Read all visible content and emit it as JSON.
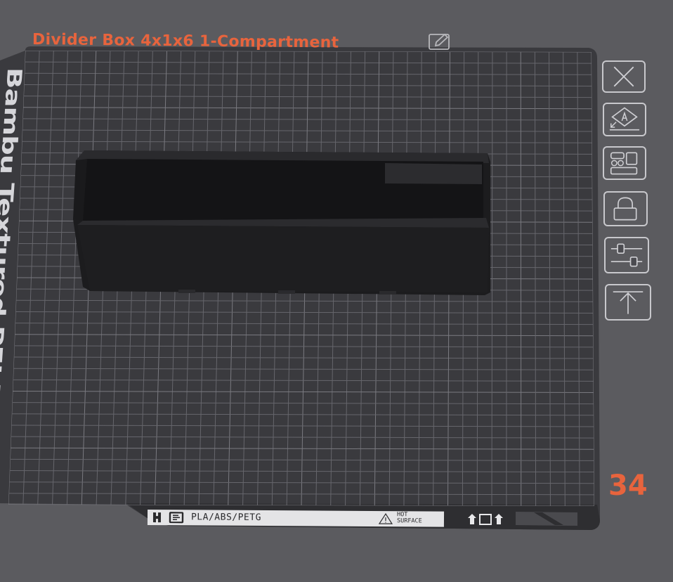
{
  "plate": {
    "title": "Divider Box 4x1x6 1-Compartment",
    "name": "Bambu Textured PEI Plate",
    "number": "34",
    "material_label": "PLA/ABS/PETG",
    "warning_label": "HOT\nSURFACE"
  },
  "icons": {
    "edit": "pencil-edit-icon",
    "close": "close-icon",
    "auto_orient": "auto-orient-icon",
    "arrange": "arrange-icon",
    "lock": "lock-icon",
    "settings": "slider-settings-icon",
    "move_top": "move-to-top-icon"
  },
  "colors": {
    "accent": "#e8643d",
    "background": "#5b5b5f",
    "plate": "#3a3a3e",
    "grid": "#6a6a70",
    "object": "#1e1e20"
  }
}
